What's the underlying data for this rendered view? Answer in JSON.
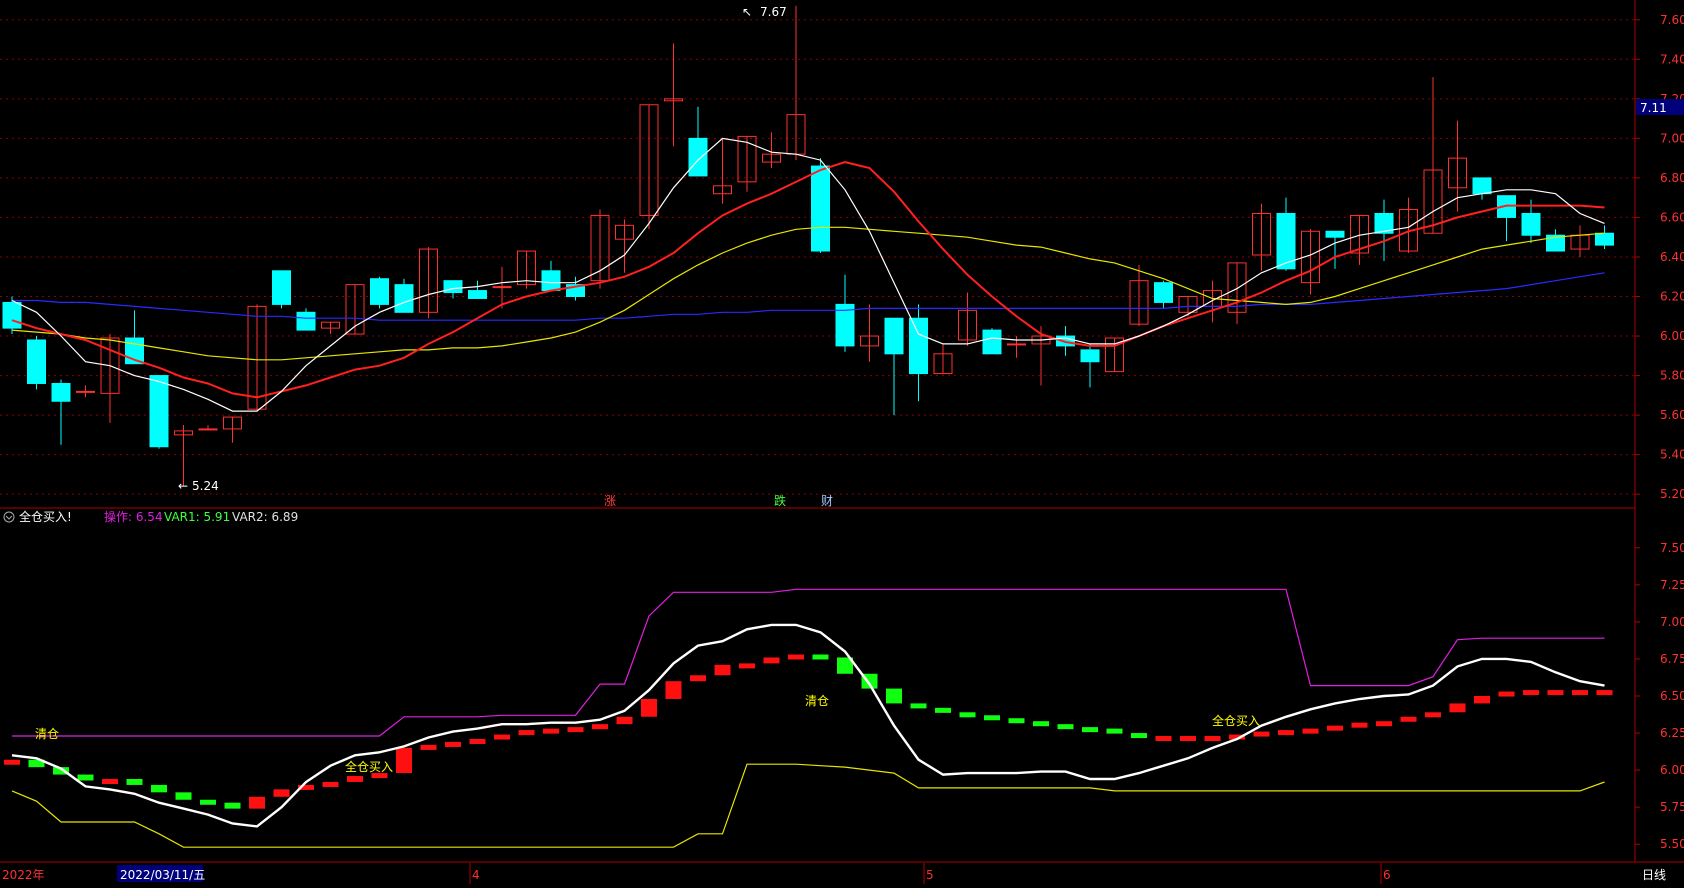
{
  "colors": {
    "up": "#ff3030",
    "down": "#00ffff",
    "ma5": "#ffffff",
    "ma10": "#ff2020",
    "ma20": "#e6e600",
    "ma60": "#2a2aff",
    "grid": "#8b0000",
    "axis": "#b00000",
    "vol_up": "#ff1010",
    "vol_down": "#10ff10",
    "mag": "#e020e0"
  },
  "main": {
    "high_label": "7.67",
    "low_label": "5.24",
    "price_badge": "7.11",
    "events": [
      "涨",
      "跌",
      "财"
    ]
  },
  "indicator": {
    "title": "全仓买入!",
    "op_label": "操作: 6.54",
    "var1_label": "VAR1: 5.91",
    "var2_label": "VAR2: 6.89",
    "signals": [
      "清仓",
      "全仓买入",
      "清仓",
      "全仓买入"
    ]
  },
  "bottom_bar": {
    "labels": [
      "2022年",
      "2022/03/11/五",
      "4",
      "5",
      "6"
    ],
    "period": "日线"
  },
  "chart_data": [
    {
      "type": "candlestick",
      "ylim": [
        5.13,
        7.7
      ],
      "yticks": [
        "7.60",
        "7.40",
        "7.20",
        "7.00",
        "6.80",
        "6.60",
        "6.40",
        "6.20",
        "6.00",
        "5.80",
        "5.60",
        "5.40",
        "5.20"
      ],
      "ohlc": [
        [
          6.17,
          6.2,
          6.01,
          6.04
        ],
        [
          5.98,
          6.0,
          5.73,
          5.76
        ],
        [
          5.76,
          5.78,
          5.45,
          5.67
        ],
        [
          5.72,
          5.75,
          5.69,
          5.72
        ],
        [
          5.71,
          6.01,
          5.56,
          5.99
        ],
        [
          5.99,
          6.13,
          5.86,
          5.86
        ],
        [
          5.8,
          5.8,
          5.43,
          5.44
        ],
        [
          5.5,
          5.55,
          5.24,
          5.52
        ],
        [
          5.53,
          5.55,
          5.53,
          5.53
        ],
        [
          5.53,
          5.59,
          5.46,
          5.59
        ],
        [
          5.63,
          6.16,
          5.62,
          6.15
        ],
        [
          6.33,
          6.33,
          6.14,
          6.16
        ],
        [
          6.12,
          6.14,
          6.03,
          6.03
        ],
        [
          6.04,
          6.07,
          6.01,
          6.07
        ],
        [
          6.01,
          6.18,
          6.01,
          6.26
        ],
        [
          6.29,
          6.3,
          6.14,
          6.16
        ],
        [
          6.26,
          6.29,
          6.14,
          6.12
        ],
        [
          6.12,
          6.45,
          6.09,
          6.44
        ],
        [
          6.28,
          6.28,
          6.19,
          6.22
        ],
        [
          6.23,
          6.28,
          6.19,
          6.19
        ],
        [
          6.25,
          6.35,
          6.14,
          6.25
        ],
        [
          6.26,
          6.38,
          6.24,
          6.43
        ],
        [
          6.33,
          6.38,
          6.23,
          6.23
        ],
        [
          6.26,
          6.3,
          6.18,
          6.2
        ],
        [
          6.28,
          6.64,
          6.24,
          6.61
        ],
        [
          6.49,
          6.59,
          6.32,
          6.56
        ],
        [
          6.61,
          7.17,
          6.54,
          7.17
        ],
        [
          7.19,
          7.48,
          6.96,
          7.2
        ],
        [
          7.0,
          7.16,
          6.96,
          6.81
        ],
        [
          6.72,
          7.0,
          6.67,
          6.76
        ],
        [
          6.78,
          7.01,
          6.73,
          7.01
        ],
        [
          6.88,
          7.03,
          6.85,
          6.92
        ],
        [
          6.92,
          7.67,
          6.89,
          7.12
        ],
        [
          6.86,
          6.9,
          6.42,
          6.43
        ],
        [
          6.16,
          6.31,
          5.92,
          5.95
        ],
        [
          5.95,
          6.16,
          5.87,
          6.0
        ],
        [
          6.09,
          6.09,
          5.6,
          5.91
        ],
        [
          6.09,
          6.16,
          5.67,
          5.81
        ],
        [
          5.81,
          5.96,
          5.81,
          5.91
        ],
        [
          5.98,
          6.22,
          5.95,
          6.13
        ],
        [
          6.03,
          6.04,
          5.91,
          5.91
        ],
        [
          5.96,
          6.0,
          5.89,
          5.96
        ],
        [
          5.96,
          6.05,
          5.75,
          6.0
        ],
        [
          6.0,
          6.05,
          5.9,
          5.95
        ],
        [
          5.93,
          5.96,
          5.74,
          5.87
        ],
        [
          5.82,
          5.97,
          5.82,
          5.99
        ],
        [
          6.06,
          6.36,
          6.05,
          6.28
        ],
        [
          6.27,
          6.28,
          6.14,
          6.17
        ],
        [
          6.12,
          6.18,
          6.1,
          6.2
        ],
        [
          6.15,
          6.28,
          6.07,
          6.23
        ],
        [
          6.12,
          6.37,
          6.06,
          6.37
        ],
        [
          6.41,
          6.67,
          6.33,
          6.62
        ],
        [
          6.62,
          6.7,
          6.33,
          6.34
        ],
        [
          6.27,
          6.54,
          6.21,
          6.53
        ],
        [
          6.53,
          6.5,
          6.34,
          6.5
        ],
        [
          6.42,
          6.61,
          6.36,
          6.61
        ],
        [
          6.62,
          6.69,
          6.38,
          6.52
        ],
        [
          6.43,
          6.7,
          6.42,
          6.64
        ],
        [
          6.52,
          7.31,
          6.52,
          6.84
        ],
        [
          6.75,
          7.09,
          6.63,
          6.9
        ],
        [
          6.8,
          6.78,
          6.69,
          6.72
        ],
        [
          6.71,
          6.7,
          6.48,
          6.6
        ],
        [
          6.62,
          6.69,
          6.47,
          6.51
        ],
        [
          6.51,
          6.54,
          6.44,
          6.43
        ],
        [
          6.44,
          6.56,
          6.4,
          6.51
        ],
        [
          6.52,
          6.56,
          6.44,
          6.46
        ]
      ],
      "ma5": [
        6.18,
        6.12,
        6.0,
        5.87,
        5.85,
        5.8,
        5.77,
        5.73,
        5.68,
        5.62,
        5.62,
        5.72,
        5.85,
        5.95,
        6.05,
        6.12,
        6.17,
        6.21,
        6.24,
        6.25,
        6.27,
        6.28,
        6.27,
        6.27,
        6.33,
        6.41,
        6.57,
        6.75,
        6.89,
        7.0,
        6.98,
        6.93,
        6.92,
        6.89,
        6.74,
        6.53,
        6.27,
        6.01,
        5.96,
        5.96,
        5.99,
        5.98,
        5.98,
        5.99,
        5.96,
        5.96,
        6.0,
        6.05,
        6.11,
        6.18,
        6.24,
        6.32,
        6.37,
        6.41,
        6.47,
        6.51,
        6.53,
        6.55,
        6.63,
        6.7,
        6.72,
        6.74,
        6.74,
        6.72,
        6.62,
        6.57
      ],
      "ma10": [
        6.08,
        6.04,
        6.01,
        5.98,
        5.93,
        5.88,
        5.84,
        5.79,
        5.76,
        5.71,
        5.69,
        5.72,
        5.75,
        5.79,
        5.83,
        5.85,
        5.89,
        5.96,
        6.02,
        6.09,
        6.16,
        6.2,
        6.23,
        6.25,
        6.27,
        6.3,
        6.35,
        6.42,
        6.52,
        6.61,
        6.67,
        6.72,
        6.78,
        6.84,
        6.88,
        6.85,
        6.73,
        6.58,
        6.44,
        6.31,
        6.2,
        6.1,
        6.01,
        5.97,
        5.95,
        5.95,
        6.0,
        6.05,
        6.09,
        6.13,
        6.17,
        6.22,
        6.28,
        6.33,
        6.4,
        6.44,
        6.48,
        6.53,
        6.56,
        6.6,
        6.63,
        6.66,
        6.66,
        6.66,
        6.66,
        6.65
      ],
      "ma20": [
        6.03,
        6.02,
        6.01,
        5.99,
        5.98,
        5.96,
        5.94,
        5.92,
        5.9,
        5.89,
        5.88,
        5.88,
        5.89,
        5.9,
        5.91,
        5.92,
        5.93,
        5.93,
        5.94,
        5.94,
        5.95,
        5.97,
        5.99,
        6.02,
        6.07,
        6.13,
        6.21,
        6.29,
        6.36,
        6.42,
        6.47,
        6.51,
        6.54,
        6.55,
        6.55,
        6.54,
        6.53,
        6.52,
        6.51,
        6.5,
        6.48,
        6.46,
        6.45,
        6.42,
        6.39,
        6.37,
        6.33,
        6.29,
        6.24,
        6.19,
        6.18,
        6.17,
        6.16,
        6.17,
        6.2,
        6.24,
        6.28,
        6.32,
        6.36,
        6.4,
        6.44,
        6.46,
        6.48,
        6.5,
        6.51,
        6.52
      ],
      "ma60": [
        6.18,
        6.18,
        6.17,
        6.17,
        6.16,
        6.15,
        6.14,
        6.13,
        6.12,
        6.11,
        6.1,
        6.1,
        6.09,
        6.09,
        6.09,
        6.08,
        6.08,
        6.08,
        6.08,
        6.08,
        6.08,
        6.08,
        6.08,
        6.08,
        6.09,
        6.09,
        6.1,
        6.11,
        6.11,
        6.12,
        6.12,
        6.13,
        6.13,
        6.13,
        6.13,
        6.14,
        6.14,
        6.14,
        6.14,
        6.14,
        6.14,
        6.14,
        6.14,
        6.14,
        6.14,
        6.14,
        6.14,
        6.14,
        6.15,
        6.15,
        6.15,
        6.16,
        6.16,
        6.16,
        6.17,
        6.18,
        6.19,
        6.2,
        6.21,
        6.22,
        6.23,
        6.24,
        6.26,
        6.28,
        6.3,
        6.32
      ]
    },
    {
      "type": "indicator",
      "ylim": [
        5.38,
        7.62
      ],
      "yticks": [
        "7.50",
        "7.25",
        "7.00",
        "6.75",
        "6.50",
        "6.25",
        "6.00",
        "5.75",
        "5.50"
      ],
      "op": [
        6.07,
        6.02,
        5.97,
        5.93,
        5.94,
        5.9,
        5.85,
        5.8,
        5.78,
        5.74,
        5.82,
        5.87,
        5.9,
        5.92,
        5.96,
        5.98,
        6.15,
        6.17,
        6.19,
        6.21,
        6.24,
        6.27,
        6.28,
        6.29,
        6.31,
        6.36,
        6.48,
        6.6,
        6.64,
        6.71,
        6.72,
        6.76,
        6.78,
        6.76,
        6.65,
        6.55,
        6.45,
        6.42,
        6.39,
        6.37,
        6.35,
        6.33,
        6.31,
        6.29,
        6.28,
        6.25,
        6.23,
        6.23,
        6.23,
        6.23,
        6.24,
        6.26,
        6.27,
        6.28,
        6.3,
        6.32,
        6.33,
        6.36,
        6.39,
        6.45,
        6.5,
        6.53,
        6.54,
        6.54,
        6.54,
        6.54
      ],
      "var2": [
        6.1,
        6.08,
        6.01,
        5.89,
        5.87,
        5.84,
        5.78,
        5.74,
        5.7,
        5.64,
        5.62,
        5.75,
        5.92,
        6.03,
        6.1,
        6.12,
        6.16,
        6.22,
        6.26,
        6.28,
        6.31,
        6.31,
        6.32,
        6.32,
        6.34,
        6.4,
        6.54,
        6.72,
        6.84,
        6.87,
        6.95,
        6.98,
        6.98,
        6.93,
        6.8,
        6.58,
        6.3,
        6.07,
        5.97,
        5.98,
        5.98,
        5.98,
        5.99,
        5.99,
        5.94,
        5.94,
        5.98,
        6.03,
        6.08,
        6.15,
        6.21,
        6.3,
        6.36,
        6.41,
        6.45,
        6.48,
        6.5,
        6.51,
        6.57,
        6.7,
        6.75,
        6.75,
        6.73,
        6.66,
        6.6,
        6.57
      ],
      "upper": [
        6.23,
        6.23,
        6.23,
        6.23,
        6.23,
        6.23,
        6.23,
        6.23,
        6.23,
        6.23,
        6.23,
        6.23,
        6.23,
        6.23,
        6.23,
        6.23,
        6.36,
        6.36,
        6.36,
        6.36,
        6.37,
        6.37,
        6.37,
        6.37,
        6.58,
        6.58,
        7.04,
        7.2,
        7.2,
        7.2,
        7.2,
        7.2,
        7.22,
        7.22,
        7.22,
        7.22,
        7.22,
        7.22,
        7.22,
        7.22,
        7.22,
        7.22,
        7.22,
        7.22,
        7.22,
        7.22,
        7.22,
        7.22,
        7.22,
        7.22,
        7.22,
        7.22,
        7.22,
        6.57,
        6.57,
        6.57,
        6.57,
        6.57,
        6.63,
        6.88,
        6.89,
        6.89,
        6.89,
        6.89,
        6.89,
        6.89
      ],
      "lower": [
        5.86,
        5.79,
        5.65,
        5.65,
        5.65,
        5.65,
        5.57,
        5.48,
        5.48,
        5.48,
        5.48,
        5.48,
        5.48,
        5.48,
        5.48,
        5.48,
        5.48,
        5.48,
        5.48,
        5.48,
        5.48,
        5.48,
        5.48,
        5.48,
        5.48,
        5.48,
        5.48,
        5.48,
        5.57,
        5.57,
        6.04,
        6.04,
        6.04,
        6.03,
        6.02,
        6.0,
        5.98,
        5.88,
        5.88,
        5.88,
        5.88,
        5.88,
        5.88,
        5.88,
        5.88,
        5.86,
        5.86,
        5.86,
        5.86,
        5.86,
        5.86,
        5.86,
        5.86,
        5.86,
        5.86,
        5.86,
        5.86,
        5.86,
        5.86,
        5.86,
        5.86,
        5.86,
        5.86,
        5.86,
        5.86,
        5.92
      ]
    }
  ]
}
